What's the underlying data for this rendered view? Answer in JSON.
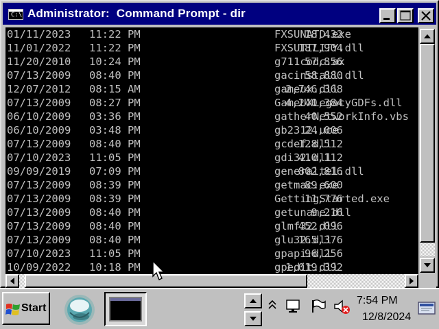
{
  "window": {
    "title": "Administrator:  Command Prompt - dir",
    "title_icon_text": "C:\\",
    "icons": {
      "minimize": "minimize-icon",
      "maximize": "maximize-icon",
      "close": "close-icon"
    }
  },
  "listing": [
    {
      "date": "01/11/2023",
      "time": "11:22 PM",
      "size": "18,432",
      "name": "FXSUNATD.exe"
    },
    {
      "date": "11/01/2022",
      "time": "11:22 PM",
      "size": "187,904",
      "name": "FXSUTILITY.dll"
    },
    {
      "date": "11/20/2010",
      "time": "10:24 PM",
      "size": "57,856",
      "name": "g711codc.ax"
    },
    {
      "date": "07/13/2009",
      "time": "08:40 PM",
      "size": "58,880",
      "name": "gacinstall.dll"
    },
    {
      "date": "12/07/2012",
      "time": "08:15 AM",
      "size": "2,746,368",
      "name": "gameux.dll"
    },
    {
      "date": "07/13/2009",
      "time": "08:27 PM",
      "size": "4,240,384",
      "name": "GameUXLegacyGDFs.dll"
    },
    {
      "date": "06/10/2009",
      "time": "03:36 PM",
      "size": "40,552",
      "name": "gatherNetworkInfo.vbs"
    },
    {
      "date": "06/10/2009",
      "time": "03:48 PM",
      "size": "24,006",
      "name": "gb2312.uce"
    },
    {
      "date": "07/13/2009",
      "time": "08:40 PM",
      "size": "128,512",
      "name": "gcdef.dll"
    },
    {
      "date": "07/10/2023",
      "time": "11:05 PM",
      "size": "410,112",
      "name": "gdi32.dll"
    },
    {
      "date": "09/09/2019",
      "time": "07:09 PM",
      "size": "802,816",
      "name": "generaltel.dll"
    },
    {
      "date": "07/13/2009",
      "time": "08:39 PM",
      "size": "89,600",
      "name": "getmac.exe"
    },
    {
      "date": "07/13/2009",
      "time": "08:39 PM",
      "size": "11,776",
      "name": "GettingStarted.exe"
    },
    {
      "date": "07/13/2009",
      "time": "08:40 PM",
      "size": "9,216",
      "name": "getuname.dll"
    },
    {
      "date": "07/13/2009",
      "time": "08:40 PM",
      "size": "452,096",
      "name": "glmf32.dll"
    },
    {
      "date": "07/13/2009",
      "time": "08:40 PM",
      "size": "165,376",
      "name": "glu32.dll"
    },
    {
      "date": "07/10/2023",
      "time": "11:05 PM",
      "size": "96,256",
      "name": "gpapi.dll"
    },
    {
      "date": "10/09/2022",
      "time": "10:18 PM",
      "size": "1,019,392",
      "name": "gpedit.dll"
    }
  ],
  "colors": {
    "console_bg": "#000000",
    "console_text": "#c0c0c0",
    "titlebar": "#000080",
    "desktop": "#008080",
    "chrome": "#c0c0c0"
  },
  "taskbar": {
    "start_label": "Start",
    "apps": [
      {
        "name": "app-round-icon"
      },
      {
        "name": "command-prompt-icon"
      }
    ],
    "tray_icons": [
      "chevron-up-icon",
      "network-icon",
      "flag-icon",
      "volume-muted-icon"
    ],
    "clock_time": "7:54 PM",
    "clock_date": "12/8/2024"
  }
}
